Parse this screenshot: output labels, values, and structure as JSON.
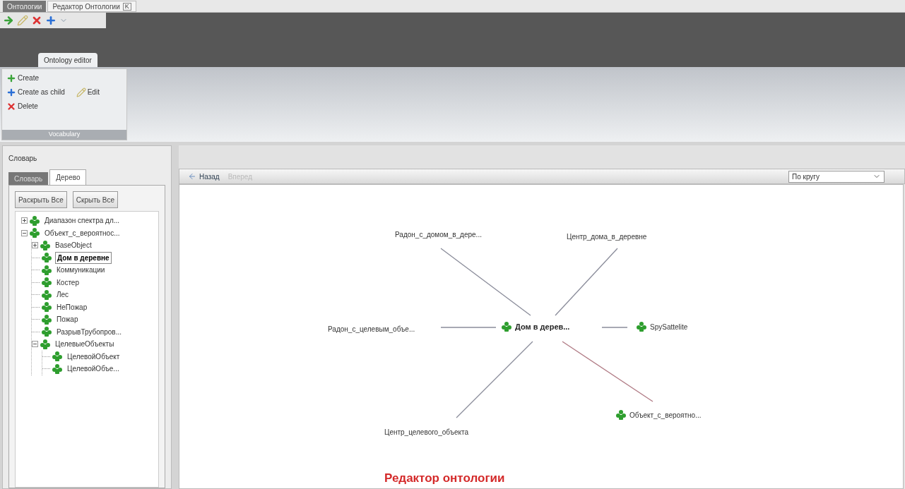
{
  "doc_tabs": [
    {
      "label": "Онтологии",
      "selected": false
    },
    {
      "label": "Редактор Онтологии",
      "selected": true,
      "close": "K"
    }
  ],
  "quick_toolbar": [
    {
      "kind": "forward"
    },
    {
      "kind": "edit"
    },
    {
      "kind": "delete"
    },
    {
      "kind": "add"
    },
    {
      "kind": "more"
    }
  ],
  "ribbon": {
    "tab": "Ontology editor",
    "group": {
      "label": "Vocabulary",
      "buttons": [
        {
          "label": "Create",
          "kind": "create"
        },
        {
          "label": "Create as child",
          "kind": "child"
        },
        {
          "label": "Edit",
          "kind": "edit"
        },
        {
          "label": "Delete",
          "kind": "delete"
        }
      ]
    }
  },
  "sidebar": {
    "title": "Словарь",
    "tabs": [
      {
        "label": "Словарь",
        "selected": false
      },
      {
        "label": "Дерево",
        "selected": true
      }
    ],
    "buttons": [
      "Раскрыть Все",
      "Скрыть Все"
    ],
    "tree": [
      {
        "label": "Диапазон спектра дл...",
        "expanded": false,
        "selected": false
      },
      {
        "label": "Объект_с_вероятнос...",
        "expanded": true,
        "selected": false,
        "children": [
          {
            "label": "BaseObject",
            "expanded": false,
            "selected": false
          },
          {
            "label": "Дом в деревне",
            "selected": true
          },
          {
            "label": "Коммуникации",
            "selected": false
          },
          {
            "label": "Костер",
            "selected": false
          },
          {
            "label": "Лес",
            "selected": false
          },
          {
            "label": "НеПожар",
            "selected": false
          },
          {
            "label": "Пожар",
            "selected": false
          },
          {
            "label": "РазрывТрубопров...",
            "selected": false
          },
          {
            "label": "ЦелевыеОбъекты",
            "expanded": true,
            "selected": false,
            "children": [
              {
                "label": "ЦелевойОбъект",
                "selected": false
              },
              {
                "label": "ЦелевойОбъе...",
                "selected": false
              }
            ]
          }
        ]
      }
    ]
  },
  "graph_toolbar": {
    "back": {
      "label": "Назад",
      "disabled": false
    },
    "forward": {
      "label": "Вперед",
      "disabled": true
    },
    "layout": {
      "value": "По кругу"
    }
  },
  "graph": {
    "center": {
      "label": "Дом в дерев..."
    },
    "nodes": [
      {
        "label": "Радон_с_домом_в_дере...",
        "kind": "property"
      },
      {
        "label": "Центр_дома_в_деревне",
        "kind": "property"
      },
      {
        "label": "Радон_с_целевым_объе...",
        "kind": "property"
      },
      {
        "label": "SpySattelite",
        "kind": "class"
      },
      {
        "label": "Объект_с_вероятно...",
        "kind": "class"
      },
      {
        "label": "Центр_целевого_объекта",
        "kind": "property"
      }
    ]
  },
  "caption": "Редактор онтологии"
}
